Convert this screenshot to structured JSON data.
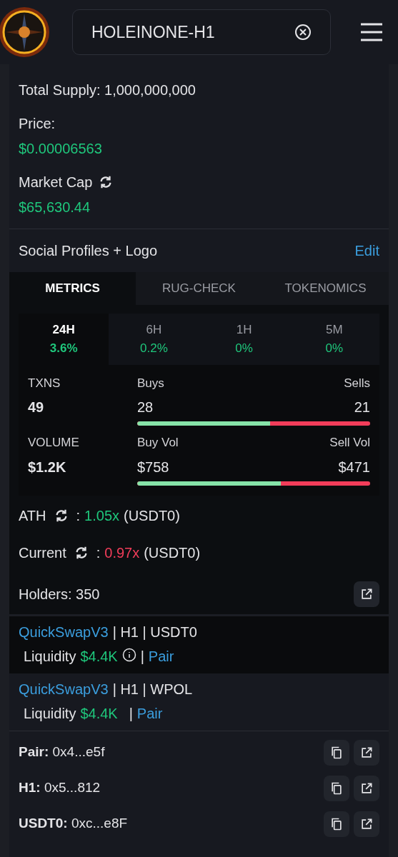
{
  "header": {
    "search": {
      "value": "HOLEINONE-H1"
    }
  },
  "summary": [
    {
      "kind": "inline",
      "label": "Total Supply: 1,000,000,000"
    },
    {
      "kind": "stacked",
      "label": "Price:",
      "value": "$0.00006563",
      "refresh": false
    },
    {
      "kind": "stacked",
      "label": "Market Cap",
      "value": "$65,630.44",
      "refresh": true
    }
  ],
  "social": {
    "label": "Social Profiles + Logo",
    "action": "Edit"
  },
  "tabs": [
    {
      "label": "METRICS",
      "selected": true
    },
    {
      "label": "RUG-CHECK",
      "selected": false
    },
    {
      "label": "TOKENOMICS",
      "selected": false
    }
  ],
  "periods": [
    {
      "label": "24H",
      "change": "3.6%",
      "selected": true
    },
    {
      "label": "6H",
      "change": "0.2%",
      "selected": false
    },
    {
      "label": "1H",
      "change": "0%",
      "selected": false
    },
    {
      "label": "5M",
      "change": "0%",
      "selected": false
    }
  ],
  "stats": [
    {
      "label": "TXNS",
      "value": "49",
      "left_label": "Buys",
      "left_value": "28",
      "right_label": "Sells",
      "right_value": "21",
      "level": 0.571
    },
    {
      "label": "VOLUME",
      "value": "$1.2K",
      "left_label": "Buy Vol",
      "left_value": "$758",
      "right_label": "Sell Vol",
      "right_value": "$471",
      "level": 0.617
    }
  ],
  "multiples": [
    {
      "label": "ATH",
      "separator": ":",
      "value": "1.05x",
      "color": "#1fc77c",
      "unit": "(USDT0)"
    },
    {
      "label": "Current",
      "separator": ":",
      "value": "0.97x",
      "color": "#f23d5a",
      "unit": "(USDT0)"
    }
  ],
  "holders": "Holders: 350",
  "pools": [
    {
      "dex": "QuickSwapV3",
      "pair": "| H1 | USDT0",
      "liquidity_label": "Liquidity",
      "liquidity": "$4.4K",
      "info": true,
      "separator": "|",
      "link": "Pair",
      "selected": true
    },
    {
      "dex": "QuickSwapV3",
      "pair": "| H1 | WPOL",
      "liquidity_label": "Liquidity",
      "liquidity": "$4.4K",
      "info": false,
      "separator": "|",
      "link": "Pair",
      "selected": false
    }
  ],
  "addresses": [
    {
      "label": "Pair:",
      "value": "0x4...e5f"
    },
    {
      "label": "H1:",
      "value": "0x5...812"
    },
    {
      "label": "USDT0:",
      "value": "0xc...e8F"
    }
  ]
}
